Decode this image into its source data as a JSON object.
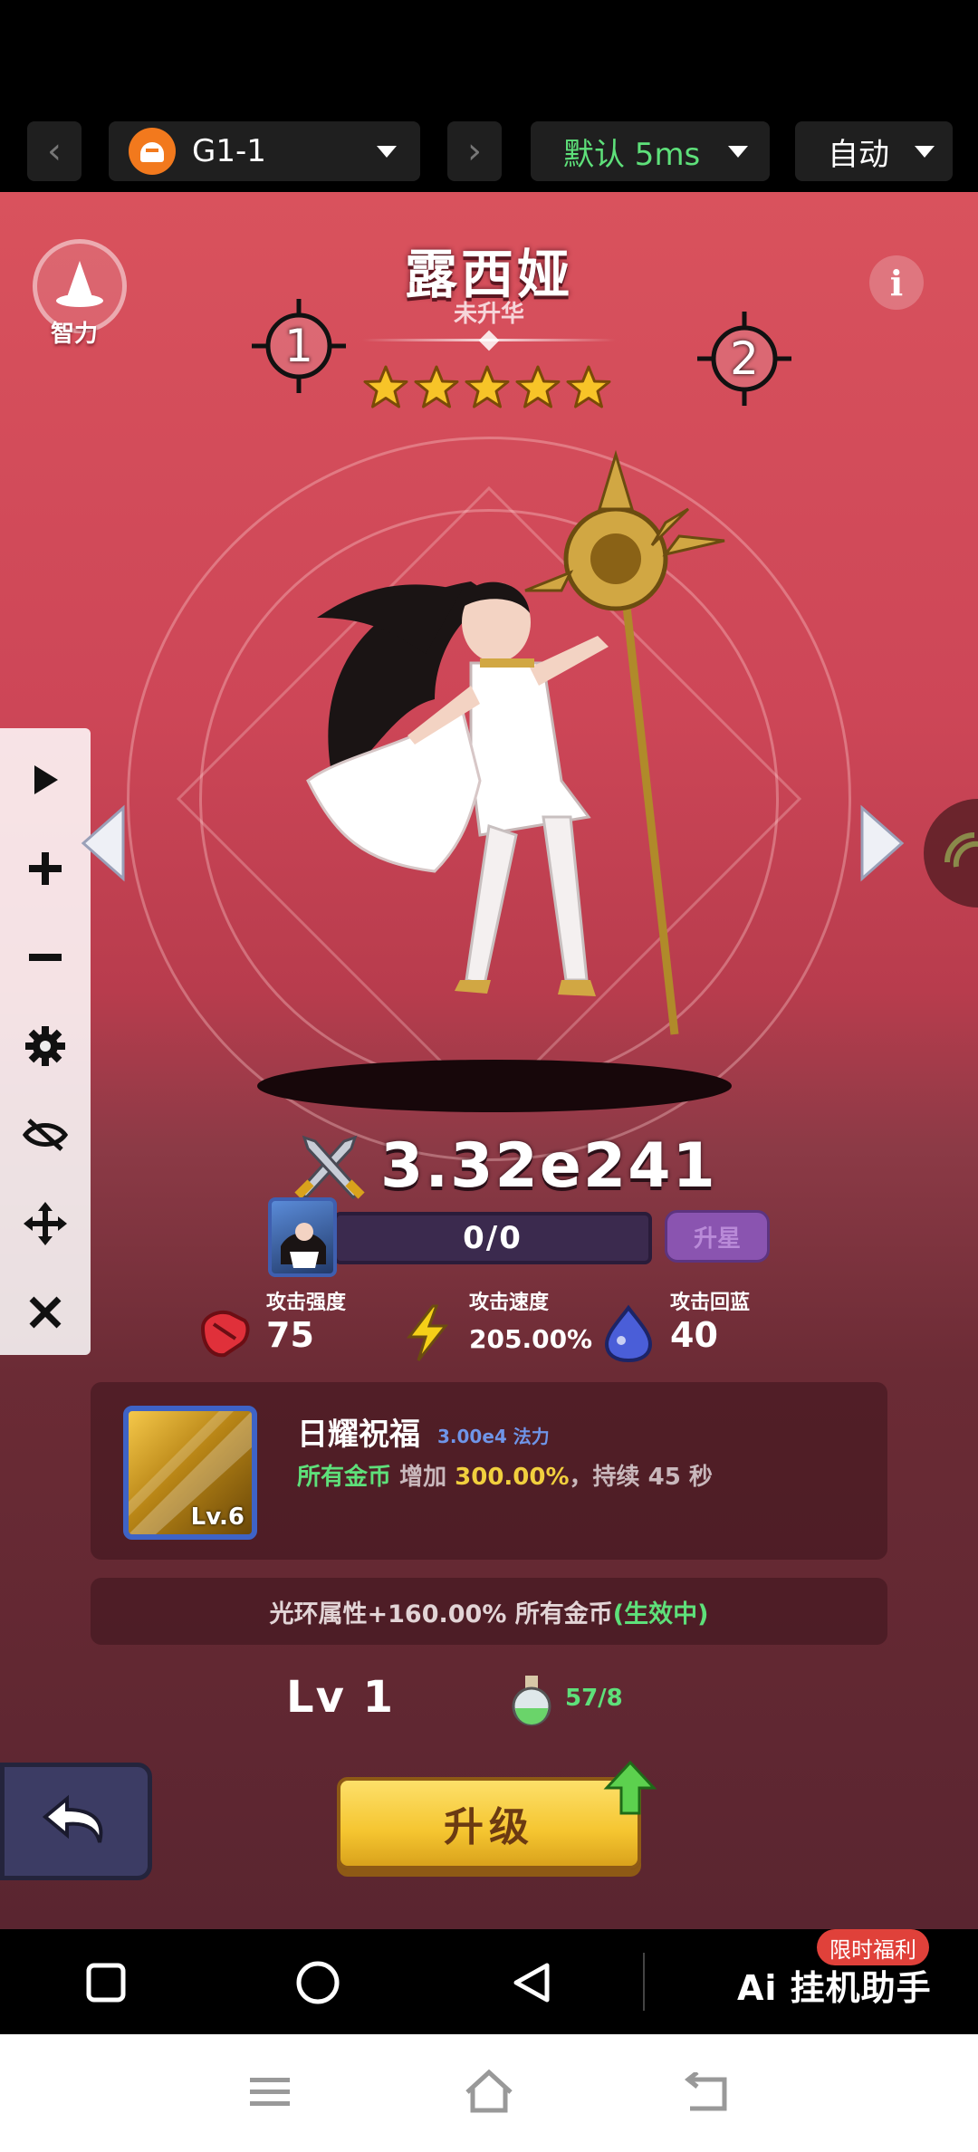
{
  "topbar": {
    "prev_label": "‹",
    "next_label": "›",
    "device_name": "G1-1",
    "latency": "默认 5ms",
    "mode": "自动"
  },
  "hero": {
    "class_label": "智力",
    "name": "露西娅",
    "subtitle": "未升华",
    "stars": 5,
    "slot_left": "1",
    "slot_right": "2",
    "info_label": "i"
  },
  "power": "3.32e241",
  "progress": {
    "text": "0/0",
    "upstar_label": "升星"
  },
  "stats": [
    {
      "label": "攻击强度",
      "value": "75"
    },
    {
      "label": "攻击速度",
      "value": "205.00%"
    },
    {
      "label": "攻击回蓝",
      "value": "40"
    }
  ],
  "skill": {
    "name": "日耀祝福",
    "cost": "3.00e4 法力",
    "level": "Lv.6",
    "desc_target": "所有金币",
    "desc_increase": "增加",
    "desc_percent": "300.00%",
    "desc_duration": "，持续 45 秒"
  },
  "aura": {
    "text": "光环属性+160.00% 所有金币",
    "status": "(生效中)"
  },
  "level": {
    "label": "Lv 1",
    "resource": "57/8"
  },
  "upgrade_label": "升级",
  "android_nav": {
    "brand": "Ai 挂机助手",
    "promo": "限时福利"
  },
  "colors": {
    "accent_red": "#d9525d",
    "gold": "#f1cf3e",
    "green": "#5ee07a",
    "panel": "#3c141c"
  }
}
